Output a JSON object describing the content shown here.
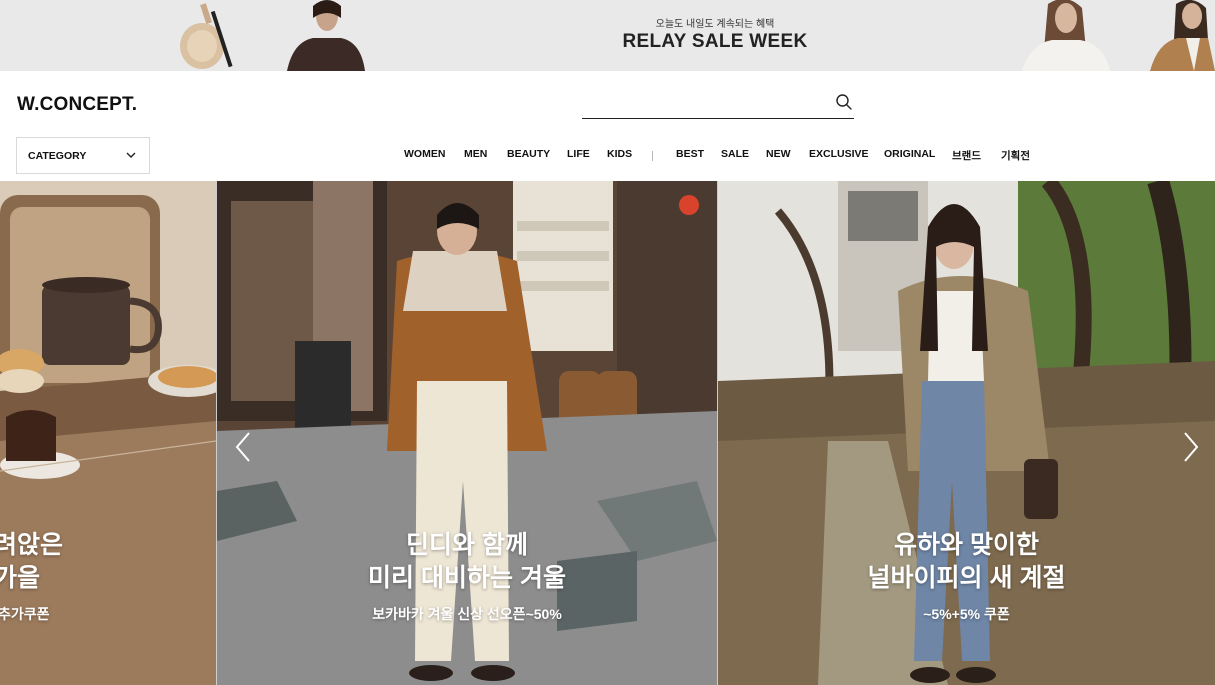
{
  "promo": {
    "subtitle": "오늘도 내일도 계속되는 혜택",
    "title": "RELAY SALE WEEK"
  },
  "header": {
    "logo": "W.CONCEPT.",
    "search": {
      "value": "",
      "placeholder": ""
    },
    "category_label": "CATEGORY"
  },
  "nav": {
    "items": [
      "WOMEN",
      "MEN",
      "BEAUTY",
      "LIFE",
      "KIDS",
      "BEST",
      "SALE",
      "NEW",
      "EXCLUSIVE",
      "ORIGINAL",
      "브랜드",
      "기획전"
    ]
  },
  "hero": {
    "slides": [
      {
        "title_line1": "려앉은",
        "title_line2": "가을",
        "desc": "추가쿠폰"
      },
      {
        "title_line1": "딘디와 함께",
        "title_line2": "미리 대비하는 겨울",
        "desc": "보카바카 겨울 신상 선오픈~50%"
      },
      {
        "title_line1": "유하와 맞이한",
        "title_line2": "널바이피의 새 계절",
        "desc": "~5%+5% 쿠폰"
      }
    ]
  },
  "icons": {
    "search": "search-icon",
    "category_toggle": "chevron-down-icon",
    "prev": "chevron-left-icon",
    "next": "chevron-right-icon"
  }
}
